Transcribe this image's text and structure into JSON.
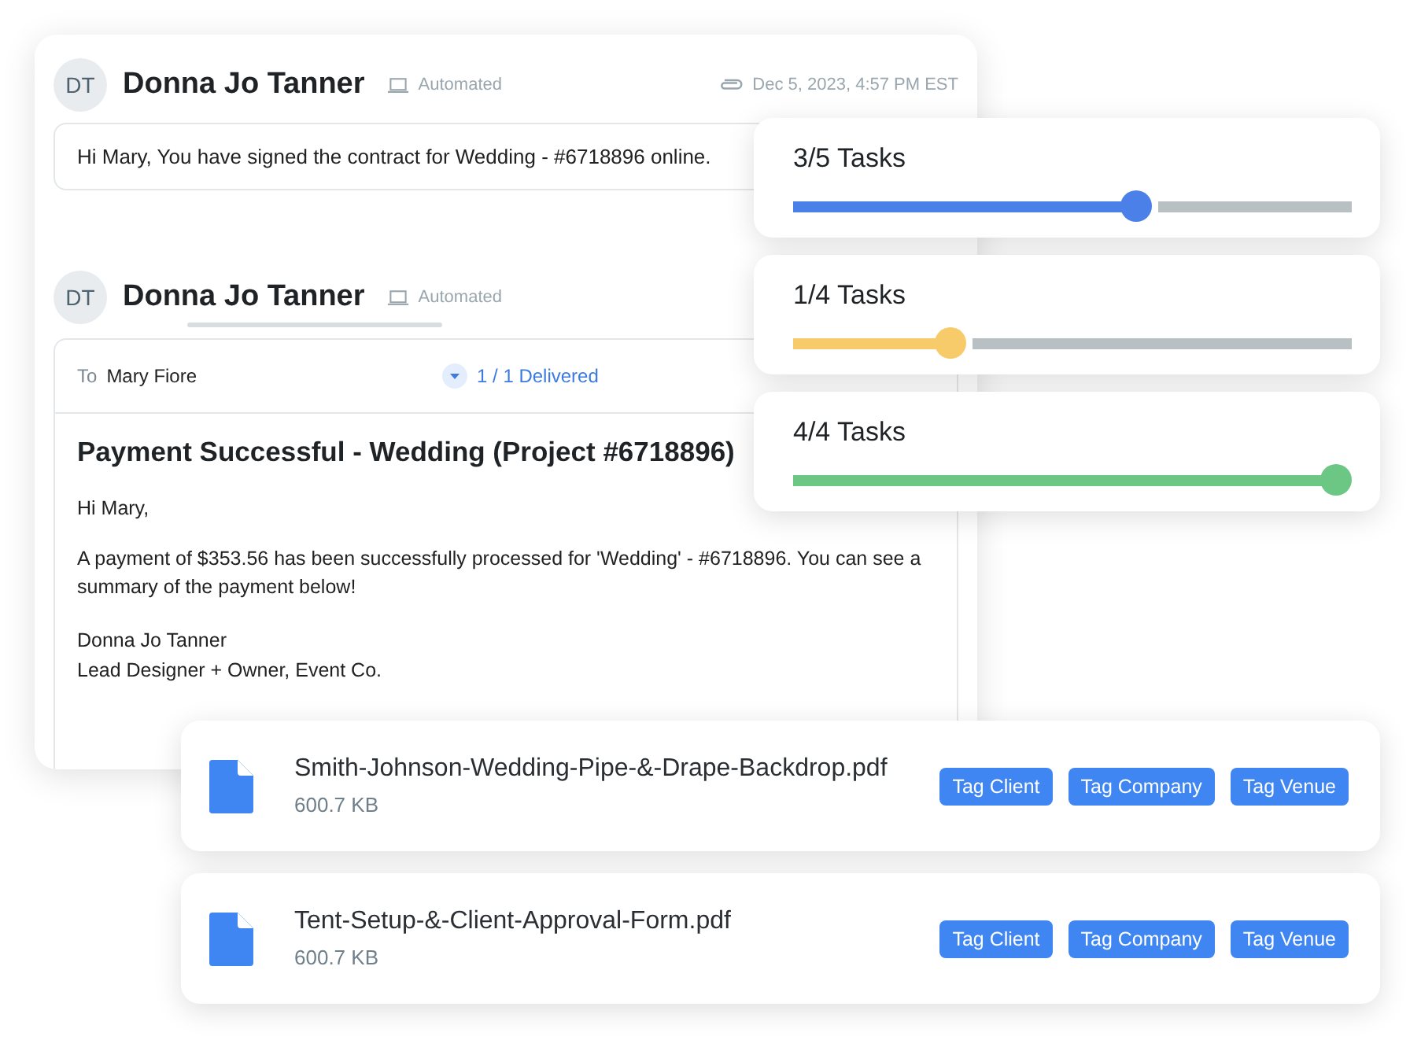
{
  "messages": [
    {
      "avatar": "DT",
      "sender": "Donna Jo Tanner",
      "source": "Automated",
      "time": "Dec 5, 2023, 4:57 PM EST",
      "kind": "note",
      "body": "Hi Mary,  You have signed the contract for Wedding - #6718896 online."
    },
    {
      "avatar": "DT",
      "sender": "Donna Jo Tanner",
      "source": "Automated",
      "kind": "email",
      "to_label": "To",
      "to": "Mary Fiore",
      "delivery": "1 / 1 Delivered",
      "subject": "Payment Successful - Wedding (Project #6718896)",
      "paragraphs": [
        "Hi Mary,",
        "A payment of $353.56 has been successfully processed for 'Wedding' - #6718896. You can see a summary of the payment below!"
      ],
      "signature": [
        "Donna Jo Tanner",
        "Lead Designer + Owner, Event Co."
      ]
    }
  ],
  "tasks": [
    {
      "label": "3/5 Tasks",
      "level": 0.62,
      "color": "#4a80e8"
    },
    {
      "label": "1/4 Tasks",
      "level": 0.27,
      "color": "#f7cb6a"
    },
    {
      "label": "4/4 Tasks",
      "level": 1,
      "color": "#6cc784"
    }
  ],
  "files": [
    {
      "name": "Smith-Johnson-Wedding-Pipe-&-Drape-Backdrop.pdf",
      "size": "600.7 KB",
      "tags": [
        "Tag Client",
        "Tag Company",
        "Tag Venue"
      ]
    },
    {
      "name": "Tent-Setup-&-Client-Approval-Form.pdf",
      "size": "600.7 KB",
      "tags": [
        "Tag Client",
        "Tag Company",
        "Tag Venue"
      ]
    }
  ]
}
